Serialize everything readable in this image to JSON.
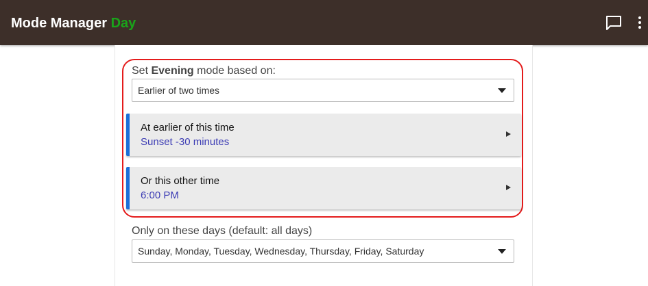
{
  "header": {
    "title": "Mode Manager",
    "mode_name": "Day",
    "chat_icon": "chat-bubble-icon",
    "more_icon": "more-vertical-icon"
  },
  "evening_section": {
    "label_prefix": "Set",
    "label_mode": "Evening",
    "label_suffix": "mode based on:",
    "select_value": "Earlier of two times",
    "cards": [
      {
        "title": "At earlier of this time",
        "value": "Sunset -30 minutes"
      },
      {
        "title": "Or this other time",
        "value": "6:00 PM"
      }
    ]
  },
  "days_section": {
    "label": "Only on these days (default: all days)",
    "select_value": "Sunday, Monday, Tuesday, Wednesday, Thursday, Friday, Saturday"
  },
  "colors": {
    "header_bg": "#3d2f29",
    "mode_green": "#1aa31a",
    "highlight_red": "#e41b1b",
    "card_accent": "#1b6fd8",
    "value_blue": "#3c3cb4"
  }
}
